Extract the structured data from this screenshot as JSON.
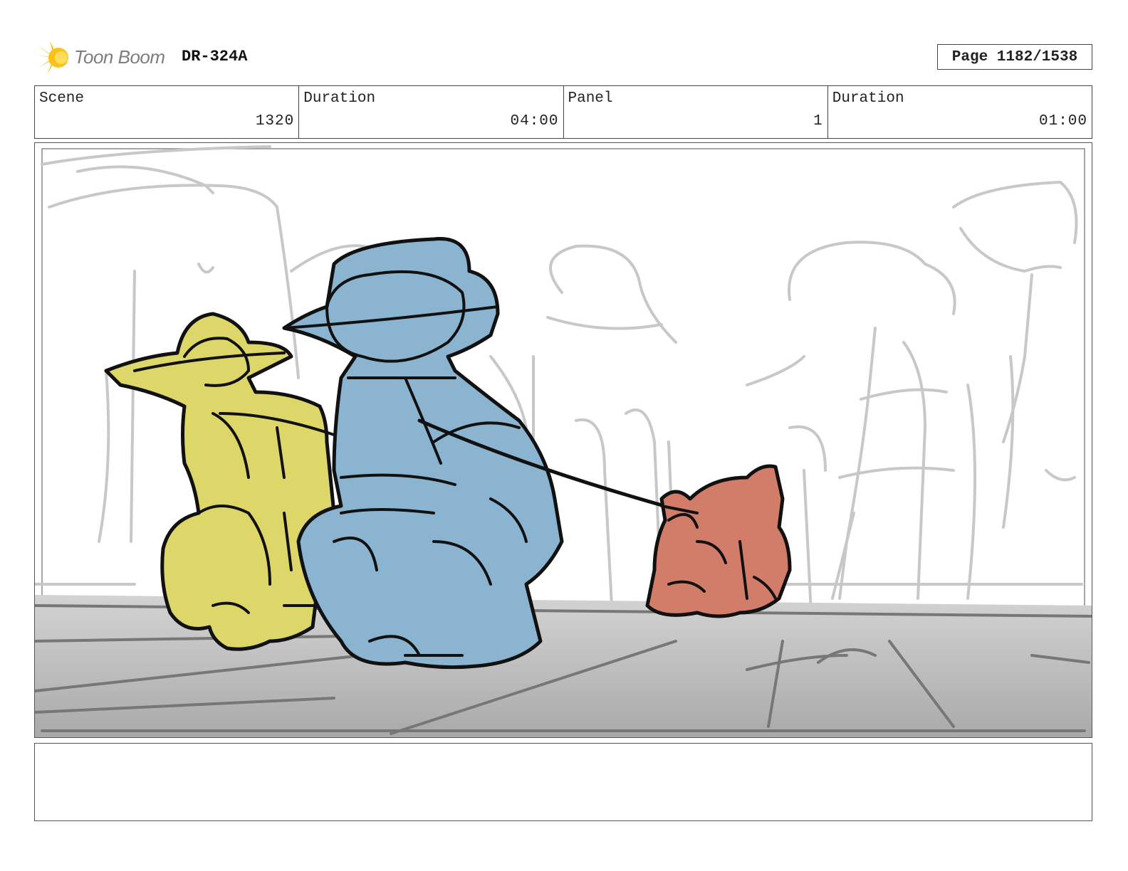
{
  "header": {
    "logo_text": "Toon Boom",
    "production_code": "DR-324A",
    "page_label": "Page 1182/1538"
  },
  "info": [
    {
      "label": "Scene",
      "value": "1320"
    },
    {
      "label": "Duration",
      "value": "04:00"
    },
    {
      "label": "Panel",
      "value": "1"
    },
    {
      "label": "Duration",
      "value": "01:00"
    }
  ],
  "colors": {
    "logo_accent": "#f5b400",
    "character_yellow": "#ddd76a",
    "character_blue": "#8ab4d0",
    "character_red": "#d27d6a",
    "ground_gray": "#b9b9b9"
  }
}
